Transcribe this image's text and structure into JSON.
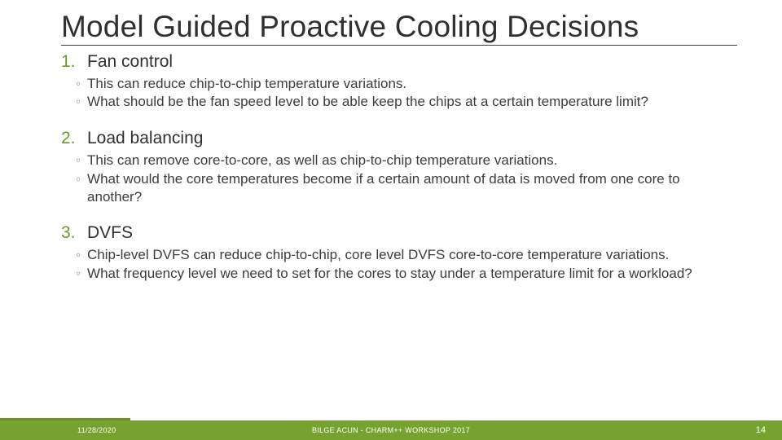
{
  "title": "Model Guided Proactive Cooling Decisions",
  "sections": [
    {
      "num": "1.",
      "heading": "Fan control",
      "bullets": [
        "This can reduce chip-to-chip temperature variations.",
        "What should be the fan speed level to be able keep the chips at a certain temperature limit?"
      ]
    },
    {
      "num": "2.",
      "heading": "Load balancing",
      "bullets": [
        "This can remove core-to-core, as well as chip-to-chip temperature variations.",
        "What would the core temperatures become if a certain amount of data is moved from one core to another?"
      ]
    },
    {
      "num": "3.",
      "heading": "DVFS",
      "bullets": [
        "Chip-level DVFS can reduce chip-to-chip, core level DVFS core-to-core temperature variations.",
        "What frequency level we need to set for the cores to stay under a temperature limit for a workload?"
      ]
    }
  ],
  "footer": {
    "date": "11/28/2020",
    "center": "BILGE ACUN - CHARM++ WORKSHOP 2017",
    "page": "14"
  }
}
